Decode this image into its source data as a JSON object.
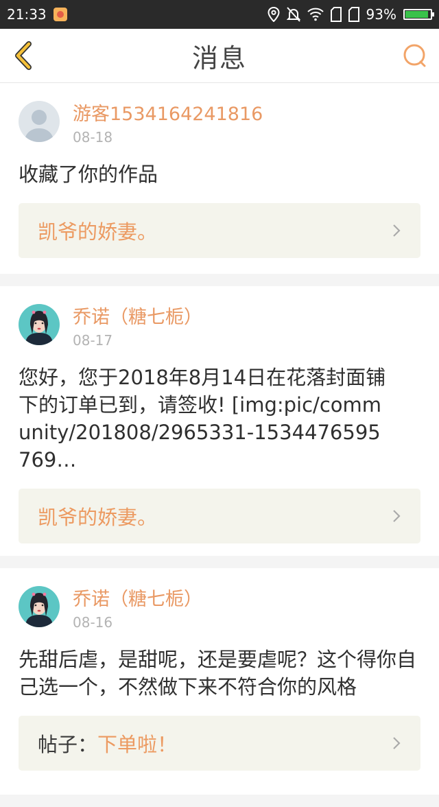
{
  "status_bar": {
    "time": "21:33",
    "battery": "93%",
    "battery_level": 0.93,
    "icons": [
      "location-icon",
      "bell-off-icon",
      "wifi-icon",
      "sim-icon",
      "sim-icon",
      "battery-icon"
    ]
  },
  "header": {
    "title": "消息",
    "back_icon": "chevron-left-icon",
    "search_icon": "search-icon",
    "accent_color": "#f5c13a",
    "search_color": "#f2a468"
  },
  "messages": [
    {
      "username": "游客1534164241816",
      "date": "08-18",
      "body": "收藏了你的作品",
      "ref_prefix": "",
      "ref_title": "凯爷的娇妻。"
    },
    {
      "username": "乔诺（糖七栀）",
      "date": "08-17",
      "body": "您好，您于2018年8月14日在花落封面铺下的订单已到，请签收! [img:pic/community/201808/2965331-1534476595769…",
      "ref_prefix": "",
      "ref_title": "凯爷的娇妻。"
    },
    {
      "username": "乔诺（糖七栀）",
      "date": "08-16",
      "body": "先甜后虐，是甜呢，还是要虐呢？这个得你自己选一个，不然做下来不符合你的风格",
      "ref_prefix": "帖子：",
      "ref_title": "下单啦！"
    }
  ],
  "colors": {
    "username": "#e99964",
    "ref_bg": "#f4f4ec",
    "ref_text": "#ec9a61"
  }
}
